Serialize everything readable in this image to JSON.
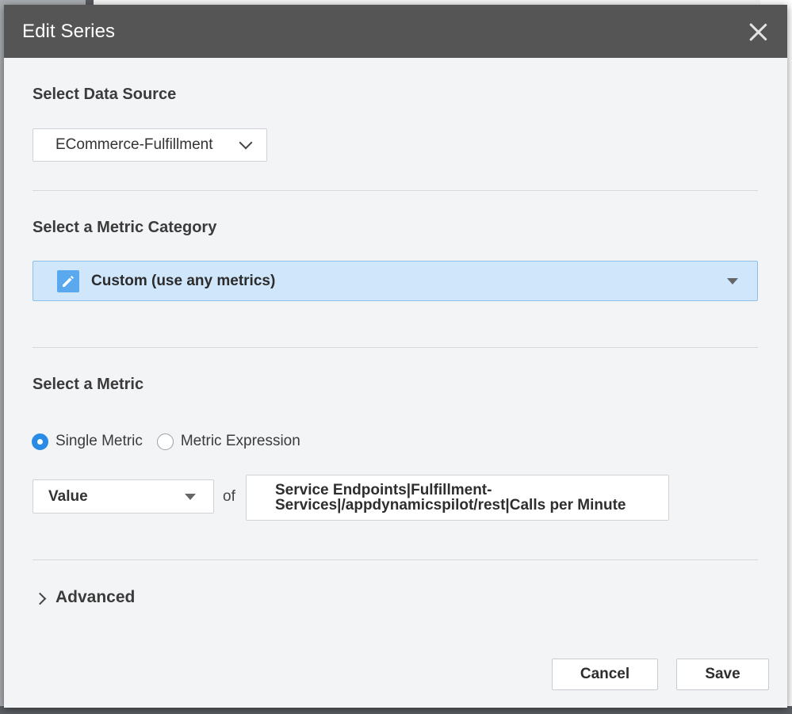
{
  "dialog": {
    "title": "Edit Series",
    "close_icon": "close-icon"
  },
  "data_source": {
    "label": "Select Data Source",
    "selected": "ECommerce-Fulfillment"
  },
  "metric_category": {
    "label": "Select a Metric Category",
    "selected": "Custom (use any metrics)",
    "icon": "pencil-icon",
    "highlight_color": "#cfe6fb"
  },
  "metric": {
    "label": "Select a Metric",
    "mode_options": [
      {
        "label": "Single Metric",
        "checked": true
      },
      {
        "label": "Metric Expression",
        "checked": false
      }
    ],
    "aggregation": "Value",
    "of_label": "of",
    "path_line1": "Service Endpoints|Fulfillment-",
    "path_line2": "Services|/appdynamicspilot/rest|Calls per Minute"
  },
  "advanced": {
    "label": "Advanced"
  },
  "footer": {
    "cancel_label": "Cancel",
    "save_label": "Save"
  },
  "colors": {
    "header": "#555555",
    "accent": "#2a8be6"
  }
}
